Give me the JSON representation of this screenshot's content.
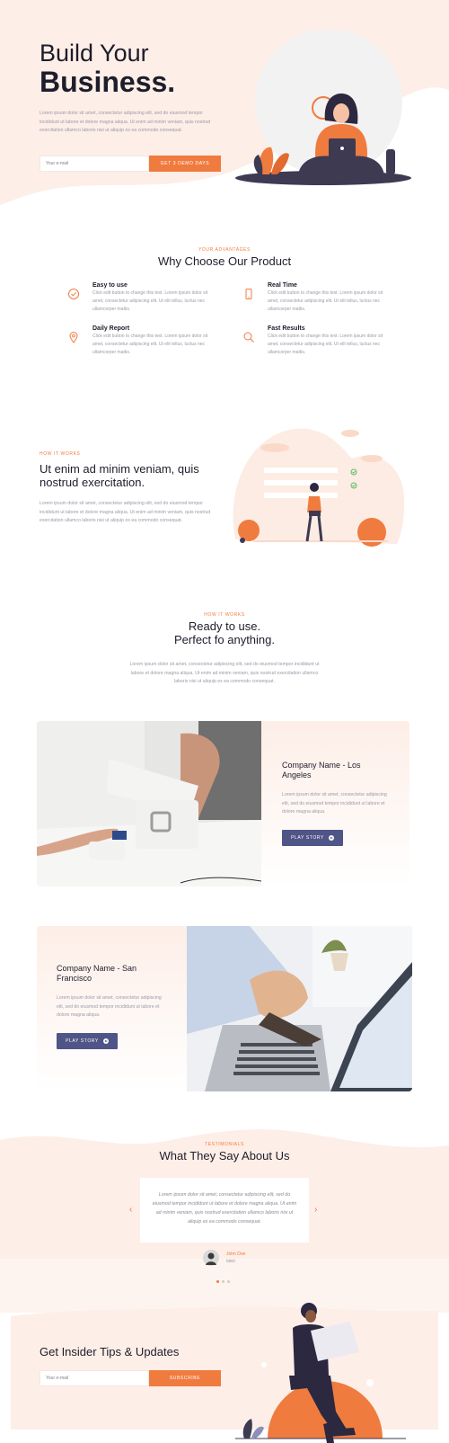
{
  "hero": {
    "title_line1": "Build Your",
    "title_line2": "Business.",
    "text": "Lorem ipsum dolor sit amet, consectetur adipiscing elit, sed do eiusmod tempor incididunt ut labore et dolore magna aliqua. Ut enim ad minim veniam, quis nostrud exercitation ullamco laboris nisi ut aliquip ex ea commodo consequat.",
    "email_placeholder": "Your e-mail",
    "cta_label": "GET 3 DEMO DAYS"
  },
  "advantages": {
    "eyebrow": "YOUR ADVANTAGES",
    "title": "Why Choose Our Product",
    "features": [
      {
        "title": "Easy to use",
        "text": "Click edit button to change this text. Lorem ipsum dolor sit amet, consectetur adipiscing elit. Ut elit tellus, luctus nec ullamcorper mattis.",
        "icon": "check-circle-icon"
      },
      {
        "title": "Real Time",
        "text": "Click edit button to change this text. Lorem ipsum dolor sit amet, consectetur adipiscing elit. Ut elit tellus, luctus nec ullamcorper mattis.",
        "icon": "phone-icon"
      },
      {
        "title": "Daily Report",
        "text": "Click edit button to change this text. Lorem ipsum dolor sit amet, consectetur adipiscing elit. Ut elit tellus, luctus nec ullamcorper mattis.",
        "icon": "map-pin-icon"
      },
      {
        "title": "Fast Results",
        "text": "Click edit button to change this text. Lorem ipsum dolor sit amet, consectetur adipiscing elit. Ut elit tellus, luctus nec ullamcorper mattis.",
        "icon": "search-icon"
      }
    ]
  },
  "how1": {
    "eyebrow": "HOW IT WORKS",
    "title": "Ut enim ad minim veniam, quis nostrud exercitation.",
    "text": "Lorem ipsum dolor sit amet, consectetur adipiscing elit, sed do eiusmod tempor incididunt ut labore et dolore magna aliqua. Ut enim ad minim veniam, quis nostrud exercitation ullamco laboris nisi ut aliquip ex ea commodo consequat."
  },
  "how2": {
    "eyebrow": "HOW IT WORKS",
    "title_line1": "Ready to use.",
    "title_line2": "Perfect fo anything.",
    "text": "Lorem ipsum dolor sit amet, consectetur adipiscing elit, sed do eiusmod tempor incididunt ut labore et dolore magna aliqua. Ut enim ad minim veniam, quis nostrud exercitation ullamco laboris nisi ut aliquip ex ea commodo consequat."
  },
  "case_la": {
    "title": "Company Name - Los Angeles",
    "text": "Lorem ipsum dolor sit amet, consectetur adipiscing elit, sed do eiusmod tempor incididunt ut labore et dolore magna aliqua.",
    "button": "PLAY STORY"
  },
  "case_sf": {
    "title": "Company Name - San Francisco",
    "text": "Lorem ipsum dolor sit amet, consectetur adipiscing elit, sed do eiusmod tempor incididunt ut labore et dolore magna aliqua.",
    "button": "PLAY STORY"
  },
  "testimonials": {
    "eyebrow": "TESTIMONIALS",
    "title": "What They Say About Us",
    "quote": "Lorem ipsum dolor sit amet, consectetur adipiscing elit, sed do eiusmod tempor incididunt ut labore et dolore magna aliqua. Ut enim ad minim veniam, quis nostrud exercitation ullamco laboris nisi ut aliquip ex ea commodo consequat.",
    "author_name": "John Doe",
    "author_role": "CEO",
    "prev": "‹",
    "next": "›"
  },
  "newsletter": {
    "title": "Get Insider Tips & Updates",
    "email_placeholder": "Your e-mail",
    "button": "SUBSCRIBE"
  },
  "colors": {
    "accent": "#f07b3f",
    "navy": "#4f5587",
    "peach": "#fdece4"
  }
}
